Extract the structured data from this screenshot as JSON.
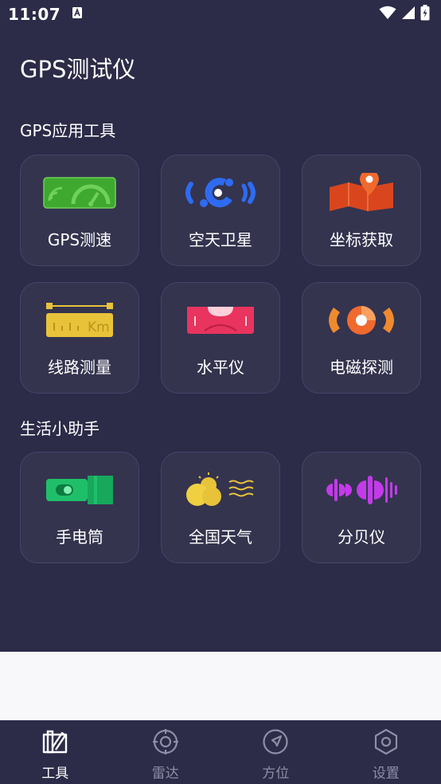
{
  "status_bar": {
    "time": "11:07"
  },
  "header": {
    "title": "GPS测试仪"
  },
  "sections": [
    {
      "title": "GPS应用工具",
      "items": [
        {
          "label": "GPS测速",
          "icon": "speedometer-icon"
        },
        {
          "label": "空天卫星",
          "icon": "satellite-icon"
        },
        {
          "label": "坐标获取",
          "icon": "map-pin-icon"
        },
        {
          "label": "线路测量",
          "icon": "ruler-icon"
        },
        {
          "label": "水平仪",
          "icon": "level-icon"
        },
        {
          "label": "电磁探测",
          "icon": "emf-detector-icon"
        }
      ]
    },
    {
      "title": "生活小助手",
      "items": [
        {
          "label": "手电筒",
          "icon": "flashlight-icon"
        },
        {
          "label": "全国天气",
          "icon": "weather-icon"
        },
        {
          "label": "分贝仪",
          "icon": "decibel-icon"
        }
      ]
    }
  ],
  "ruler_unit": "Km",
  "bottom_nav": [
    {
      "label": "工具",
      "icon": "tools-icon",
      "active": true
    },
    {
      "label": "雷达",
      "icon": "radar-icon",
      "active": false
    },
    {
      "label": "方位",
      "icon": "compass-icon",
      "active": false
    },
    {
      "label": "设置",
      "icon": "settings-icon",
      "active": false
    }
  ],
  "colors": {
    "background": "#2c2b48",
    "tile": "#34344f",
    "green": "#3ea82f",
    "blue": "#2f6bf0",
    "orange": "#f06a2e",
    "yellow": "#e8c33a",
    "pink": "#e8345e",
    "teal": "#1fbf6a",
    "purple": "#c33be8"
  }
}
